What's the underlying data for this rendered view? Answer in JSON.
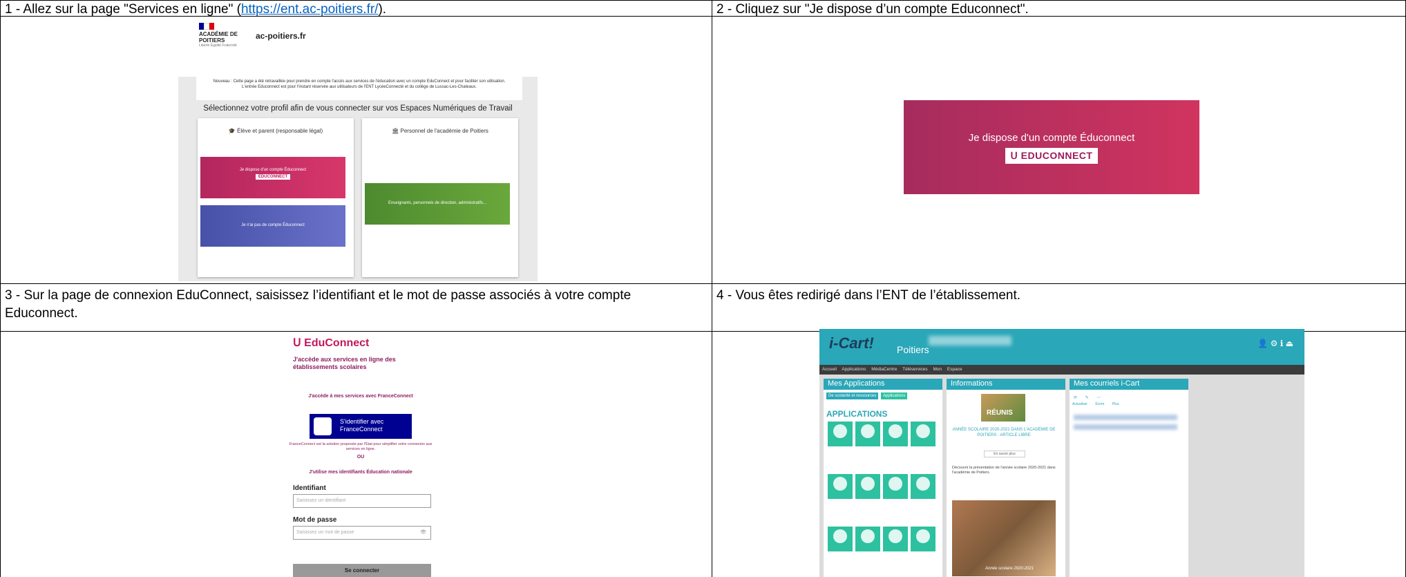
{
  "steps": [
    {
      "text_before_link": "1 - Allez sur la page \"Services en ligne\" (",
      "link": "https://ent.ac-poitiers.fr/",
      "text_after_link": ")."
    },
    {
      "text": "2 - Cliquez sur \"Je dispose d’un compte Educonnect\"."
    },
    {
      "text": "3 - Sur la page de connexion EduConnect, saisissez l’identifiant et le mot de passe associés à votre compte Educonnect."
    },
    {
      "text": "4 - Vous êtes redirigé dans l’ENT de l’établissement."
    }
  ],
  "shot1": {
    "academy": "ACADÉMIE DE POITIERS",
    "motto": "Liberté Égalité Fraternité",
    "domain": "ac-poitiers.fr",
    "notice_line1": "Nouveau : Cette page a été retravaillée pour prendre en compte l'accès aux services de l'éducation avec un compte EduConnect et pour faciliter son utilisation.",
    "notice_line2": "L'entrée Educonnect est pour l'instant réservée aux utilisateurs de l'ENT LycéeConnecté et du collège de Lussac-Les-Chateaux.",
    "choose_profile": "Sélectionnez votre profil afin de vous connecter sur vos Espaces Numériques de Travail",
    "card_left_title": "Élève et parent (responsable légal)",
    "card_right_title": "Personnel de l'académie de Poitiers",
    "btn_educonnect": "Je dispose d'un compte Éduconnect",
    "btn_educonnect_badge": "EDUCONNECT",
    "btn_no_account": "Je n'ai pas de compte Éduconnect",
    "btn_staff": "Enseignants, personnels de direction, administratifs..."
  },
  "shot2": {
    "text": "Je dispose d'un compte Éduconnect",
    "badge": "EDUCONNECT"
  },
  "shot3": {
    "brand": "EduConnect",
    "heading": "J'accède aux services en ligne des établissements scolaires",
    "fc_intro": "J'accède à mes services avec FranceConnect",
    "fc_button": "S'identifier avec FranceConnect",
    "fc_note": "FranceConnect est la solution proposée par l'État pour simplifier votre connexion aux services en ligne.",
    "or": "OU",
    "en_ids": "J'utilise mes identifiants Éducation nationale",
    "id_label": "Identifiant",
    "id_placeholder": "Saisissez un identifiant",
    "pwd_label": "Mot de passe",
    "pwd_placeholder": "Saisissez un mot de passe",
    "submit": "Se connecter"
  },
  "shot4": {
    "logo": "i-Cart!",
    "city": "Poitiers",
    "nav": "Accueil Applications MédiaCentre Téléservices Mon Espace",
    "col1_title": "Mes Applications",
    "col1_tab1": "De scolarité et ressources",
    "col1_tab2": "Applications",
    "col1_heading": "APPLICATIONS",
    "col2_title": "Informations",
    "news_badge": "RÉUNIS",
    "news_title": "ANNÉE SCOLAIRE 2020-2021 DANS L'ACADÉMIE DE POITIERS - ARTICLE LIBRE",
    "news_more": "En savoir plus",
    "news_text": "Découvrir la présentation de l'année scolaire 2020-2021 dans l'académie de Poitiers.",
    "news_photo_caption": "Année scolaire 2020-2021",
    "col3_title": "Mes courriels i-Cart",
    "mail_actions": [
      "Actualiser",
      "Écrire",
      "Plus"
    ]
  }
}
